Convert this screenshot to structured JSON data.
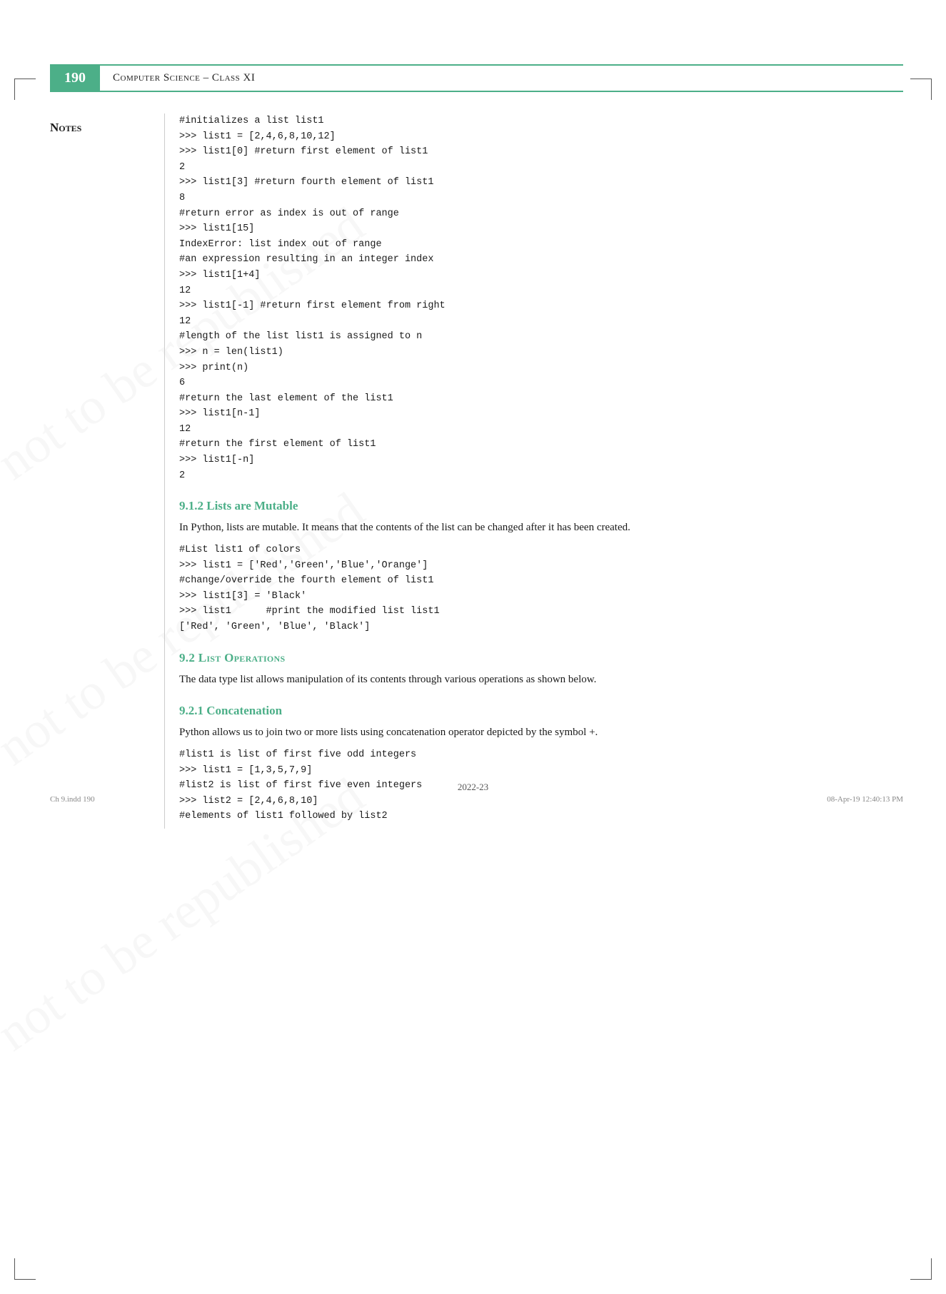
{
  "page": {
    "number": "190",
    "header_title": "Computer Science – Class XI",
    "footer_year": "2022-23",
    "footer_file": "Ch 9.indd  190",
    "footer_date": "08-Apr-19  12:40:13 PM"
  },
  "sidebar": {
    "notes_label": "Notes"
  },
  "code_sections": {
    "section1": "#initializes a list list1\n>>> list1 = [2,4,6,8,10,12]\n>>> list1[0] #return first element of list1\n2\n>>> list1[3] #return fourth element of list1\n8\n#return error as index is out of range\n>>> list1[15]\nIndexError: list index out of range\n#an expression resulting in an integer index\n>>> list1[1+4]\n12\n>>> list1[-1] #return first element from right\n12\n#length of the list list1 is assigned to n\n>>> n = len(list1)\n>>> print(n)\n6\n#return the last element of the list1\n>>> list1[n-1]\n12\n#return the first element of list1\n>>> list1[-n]\n2",
    "section2": "#List list1 of colors\n>>> list1 = ['Red','Green','Blue','Orange']\n#change/override the fourth element of list1\n>>> list1[3] = 'Black'\n>>> list1      #print the modified list list1\n['Red', 'Green', 'Blue', 'Black']",
    "section3": "#list1 is list of first five odd integers\n>>> list1 = [1,3,5,7,9]\n#list2 is list of first five even integers\n>>> list2 = [2,4,6,8,10]\n#elements of list1 followed by list2"
  },
  "headings": {
    "h912": "9.1.2 Lists are Mutable",
    "h92": "9.2 List Operations",
    "h921": "9.2.1 Concatenation"
  },
  "body_text": {
    "mutable_para": "In Python, lists are mutable. It means that the contents of the list can be changed after it has been created.",
    "list_ops_para": "The data type list allows manipulation of its contents through various operations as shown below.",
    "concat_para": "Python allows us to join two or more lists using concatenation operator depicted by the symbol +."
  }
}
